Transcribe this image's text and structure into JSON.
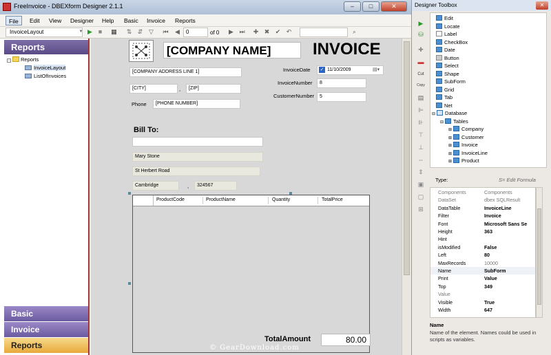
{
  "window": {
    "title": "FreeInvoice - DBEXform Designer 2.1.1",
    "min": "–",
    "max": "□",
    "close": "✕"
  },
  "menu": [
    "File",
    "Edit",
    "View",
    "Designer",
    "Help",
    "Basic",
    "Invoice",
    "Reports"
  ],
  "toolbar": {
    "layout_combo": "InvoiceLayout",
    "record_value": "0",
    "record_of": "of 0"
  },
  "left_panel": {
    "header": "Reports",
    "tree": {
      "root": "Reports",
      "children": [
        "InvoiceLayout",
        "ListOfInvoices"
      ]
    },
    "bottom_buttons": [
      {
        "label": "Basic",
        "selected": false
      },
      {
        "label": "Invoice",
        "selected": false
      },
      {
        "label": "Reports",
        "selected": true
      }
    ]
  },
  "form": {
    "company_name": "[COMPANY NAME]",
    "invoice_title": "INVOICE",
    "address_line1": "[COMPANY ADDRESS LINE 1]",
    "city": "[CITY]",
    "comma": ",",
    "zip": "[ZIP]",
    "phone_label": "Phone",
    "phone": "[PHONE NUMBER]",
    "invoice_date_label": "InvoiceDate",
    "invoice_date": "11/10/2009",
    "invoice_number_label": "InvoiceNumber",
    "invoice_number": "8",
    "customer_number_label": "CustomerNumber",
    "customer_number": "5",
    "bill_to_label": "Bill To:",
    "bill_name": "Mary Stone",
    "bill_street": "St Herbert Road",
    "bill_city": "Cambridge",
    "bill_comma": ",",
    "bill_zip": "324567",
    "grid_columns": [
      "ProductCode",
      "ProductName",
      "Quantity",
      "TotalPrice"
    ],
    "total_label": "TotalAmount",
    "total_value": "80.00"
  },
  "watermark": "© GearDownload.com",
  "toolbox": {
    "title": "Designer Toolbox",
    "close": "✕",
    "items": [
      "Edit",
      "Locate",
      "Label",
      "CheckBox",
      "Date",
      "Button",
      "Select",
      "Shape",
      "SubForm",
      "Grid",
      "Tab",
      "Net"
    ],
    "database": "Database",
    "tables": "Tables",
    "table_items": [
      "Company",
      "Customer",
      "Invoice",
      "InvoiceLine",
      "Product"
    ],
    "type_label": "Type:",
    "edit_formula": "S= Edit Formula",
    "properties": [
      {
        "name": "Components",
        "value": "Components",
        "bold": false
      },
      {
        "name": "DataSet",
        "value": "dbex SQLResult",
        "bold": false
      },
      {
        "name": "DataTable",
        "value": "InvoiceLine",
        "bold": true
      },
      {
        "name": "Filter",
        "value": "Invoice",
        "bold": true
      },
      {
        "name": "Font",
        "value": "Microsoft Sans Se",
        "bold": true
      },
      {
        "name": "Height",
        "value": "363",
        "bold": true
      },
      {
        "name": "Hint",
        "value": "",
        "bold": false
      },
      {
        "name": "isModified",
        "value": "False",
        "bold": true
      },
      {
        "name": "Left",
        "value": "80",
        "bold": true
      },
      {
        "name": "MaxRecords",
        "value": "10000",
        "bold": false
      },
      {
        "name": "Name",
        "value": "SubForm",
        "bold": true
      },
      {
        "name": "Print",
        "value": "Value",
        "bold": true
      },
      {
        "name": "Top",
        "value": "349",
        "bold": true
      },
      {
        "name": "Value",
        "value": "",
        "bold": false
      },
      {
        "name": "Visible",
        "value": "True",
        "bold": true
      },
      {
        "name": "Width",
        "value": "647",
        "bold": true
      }
    ],
    "desc_title": "Name",
    "desc_text": "Name of the element. Names could be used in scripts as variables."
  }
}
